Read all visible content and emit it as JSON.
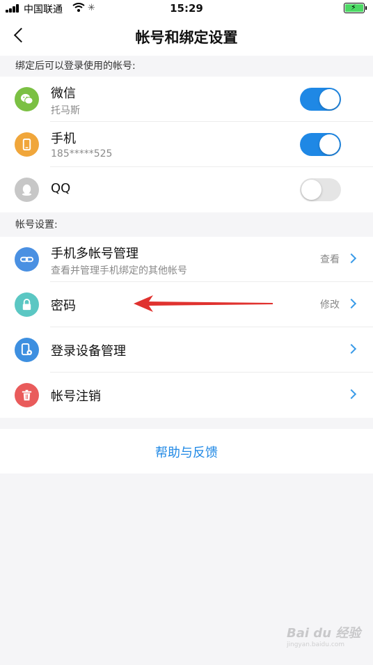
{
  "status_bar": {
    "carrier": "中国联通",
    "time": "15:29"
  },
  "nav": {
    "title": "帐号和绑定设置"
  },
  "bindings_section": {
    "header": "绑定后可以登录使用的帐号:",
    "items": [
      {
        "title": "微信",
        "subtitle": "托马斯",
        "icon": "wechat-icon",
        "icon_color": "#7bc043",
        "enabled": true
      },
      {
        "title": "手机",
        "subtitle": "185*****525",
        "icon": "phone-icon",
        "icon_color": "#f0a63b",
        "enabled": true
      },
      {
        "title": "QQ",
        "icon": "qq-icon",
        "icon_color": "#c7c7c7",
        "enabled": false
      }
    ]
  },
  "account_section": {
    "header": "帐号设置:",
    "items": [
      {
        "title": "手机多帐号管理",
        "subtitle": "查看并管理手机绑定的其他帐号",
        "action": "查看",
        "icon": "link-icon",
        "icon_color": "#4a90e2"
      },
      {
        "title": "密码",
        "action": "修改",
        "icon": "lock-icon",
        "icon_color": "#5bc7c3"
      },
      {
        "title": "登录设备管理",
        "icon": "device-icon",
        "icon_color": "#3d8fe0"
      },
      {
        "title": "帐号注销",
        "icon": "trash-icon",
        "icon_color": "#e95b5b"
      }
    ]
  },
  "help": {
    "label": "帮助与反馈"
  },
  "watermark": {
    "brand": "Bai du 经验",
    "domain": "jingyan.baidu.com"
  },
  "colors": {
    "accent": "#1f88e5",
    "annotation_arrow": "#e0322f"
  }
}
